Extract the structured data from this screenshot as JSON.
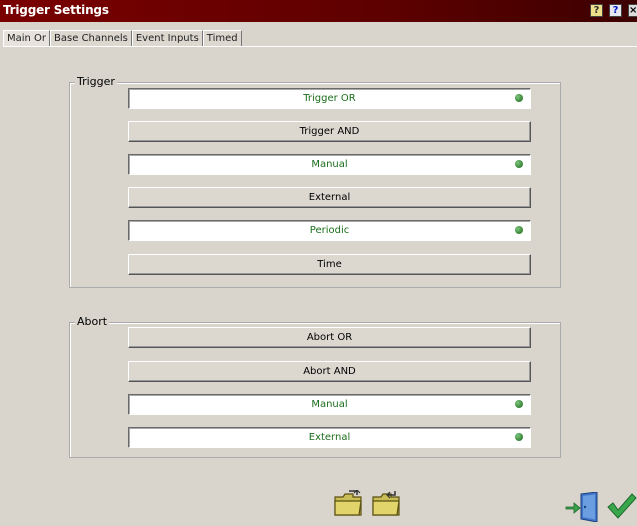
{
  "window": {
    "title": "Trigger Settings",
    "buttons": {
      "hint": "?",
      "help": "?"
    }
  },
  "tabs": [
    {
      "label": "Main Or",
      "active": true
    },
    {
      "label": "Base Channels",
      "active": false
    },
    {
      "label": "Event Inputs",
      "active": false
    },
    {
      "label": "Timed",
      "active": false
    }
  ],
  "trigger": {
    "legend": "Trigger",
    "options": [
      {
        "label": "Trigger OR",
        "selected": true
      },
      {
        "label": "Trigger AND",
        "selected": false
      },
      {
        "label": "Manual",
        "selected": true
      },
      {
        "label": "External",
        "selected": false
      },
      {
        "label": "Periodic",
        "selected": true
      },
      {
        "label": "Time",
        "selected": false
      }
    ]
  },
  "abort": {
    "legend": "Abort",
    "options": [
      {
        "label": "Abort OR",
        "selected": false
      },
      {
        "label": "Abort AND",
        "selected": false
      },
      {
        "label": "Manual",
        "selected": true
      },
      {
        "label": "External",
        "selected": true
      }
    ]
  },
  "footer": {
    "icons": [
      "open-folder-icon",
      "save-folder-icon",
      "exit-door-icon",
      "ok-checkmark-icon"
    ]
  },
  "colors": {
    "title_bar": "#7a0000",
    "selected_text": "#1a6e1a",
    "indicator": "#3d8c3d",
    "background": "#d9d5cd"
  }
}
